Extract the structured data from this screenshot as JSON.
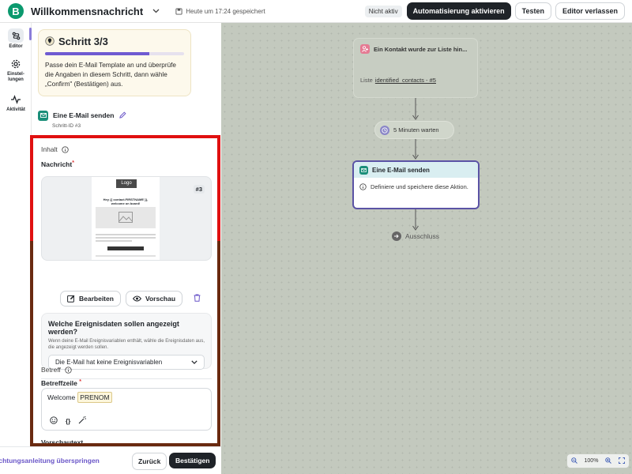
{
  "topbar": {
    "brand_letter": "B",
    "title": "Willkommensnachricht",
    "saved_text": "Heute um 17:24 gespeichert",
    "status_badge": "Nicht aktiv",
    "activate_label": "Automatisierung aktivieren",
    "test_label": "Testen",
    "leave_label": "Editor verlassen"
  },
  "leftnav": {
    "items": [
      {
        "label": "Editor",
        "icon": "editor-icon"
      },
      {
        "label": "Einstel-\nlungen",
        "icon": "gear-icon"
      },
      {
        "label": "Aktivität",
        "icon": "activity-icon"
      }
    ]
  },
  "step": {
    "title": "Schritt 3/3",
    "progress": 0.75,
    "description": "Passe dein E-Mail Template an und überprüfe die Angaben in diesem Schritt, dann wähle „Confirm\" (Bestätigen) aus."
  },
  "action": {
    "name": "Eine E-Mail senden",
    "id_text": "Schritt-ID #3"
  },
  "content": {
    "section_label": "Inhalt",
    "message_label": "Nachricht",
    "preview": {
      "logo": "Logo",
      "greeting": "Hey {{ contact.FIRSTNAME }},\nwelcome on board!",
      "badge": "#3"
    },
    "edit_label": "Bearbeiten",
    "preview_label": "Vorschau",
    "event_title": "Welche Ereignisdaten sollen angezeigt werden?",
    "event_desc": "Wenn deine E-Mail Ereignisvariablen enthält, wähle die Ereignisdaten aus, die angezeigt werden sollen.",
    "event_select": "Die E-Mail hat keine Ereignisvariablen",
    "subject_section": "Betreff",
    "subject_label": "Betreffzeile",
    "subject_text": "Welcome",
    "subject_token": "PRENOM",
    "preheader_label": "Vorschautext"
  },
  "footer": {
    "skip_label": "ichtungsanleitung überspringen",
    "back_label": "Zurück",
    "confirm_label": "Bestätigen"
  },
  "canvas": {
    "trigger_title": "Ein Kontakt wurde zur Liste hin...",
    "trigger_list_prefix": "Liste",
    "trigger_list": "identified_contacts - #5",
    "wait_label": "5 Minuten warten",
    "email_title": "Eine E-Mail senden",
    "email_body": "Definiere und speichere diese Aktion.",
    "end_label": "Ausschluss",
    "zoom": "100%"
  },
  "colors": {
    "brand": "#0b996e",
    "accent": "#6f5bd1",
    "dark_button": "#1f2328",
    "canvas_bg": "#c3c9be",
    "selected_node_border": "#5b53a5"
  }
}
